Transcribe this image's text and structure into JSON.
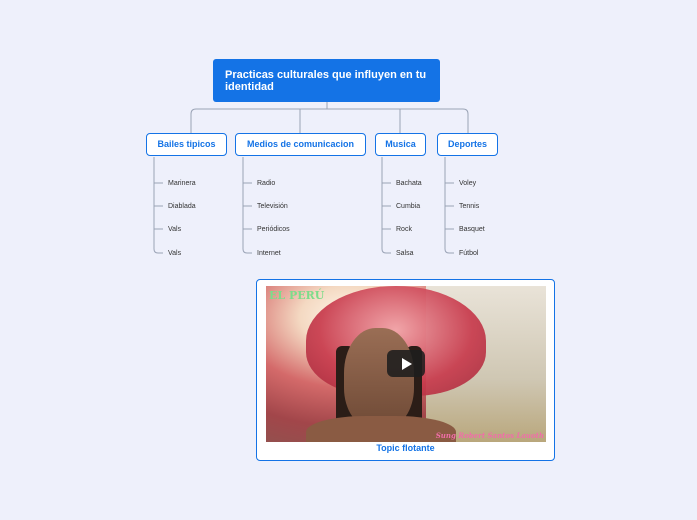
{
  "root": {
    "title": "Practicas culturales que influyen en tu identidad"
  },
  "branches": [
    {
      "label": "Bailes tipicos",
      "leaves": [
        "Marinera",
        "Diablada",
        "Vals",
        "Vals"
      ]
    },
    {
      "label": "Medios de comunicacion",
      "leaves": [
        "Radio",
        "Televisión",
        "Periódicos",
        "Internet"
      ]
    },
    {
      "label": "Musica",
      "leaves": [
        "Bachata",
        "Cumbia",
        "Rock",
        "Salsa"
      ]
    },
    {
      "label": "Deportes",
      "leaves": [
        "Voley",
        "Tennis",
        "Basquet",
        "Fútbol"
      ]
    }
  ],
  "floating_topic": {
    "caption": "Topic flotante",
    "video_overlay_title": "EL PERÚ",
    "video_overlay_credit": "Sung Robert Santos Lauoth"
  },
  "colors": {
    "accent": "#1473e6",
    "background": "#eef0fb",
    "connector": "#9aa3b5"
  }
}
